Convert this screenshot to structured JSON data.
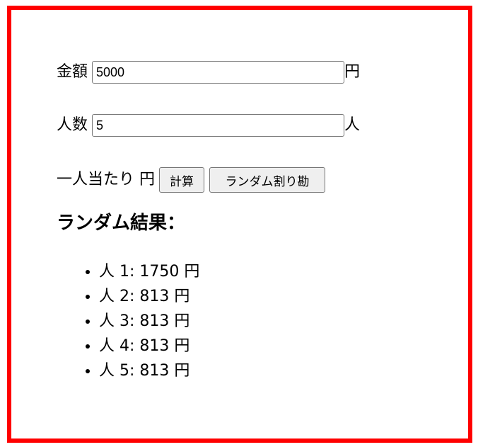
{
  "form": {
    "amount_label": "金額",
    "amount_value": "5000",
    "amount_unit": "円",
    "people_label": "人数",
    "people_value": "5",
    "people_unit": "人",
    "per_person_label": "一人当たり 円",
    "calc_button": "計算",
    "random_button": "ランダム割り勘"
  },
  "results": {
    "heading": "ランダム結果：",
    "items": [
      "人 1: 1750 円",
      "人 2: 813 円",
      "人 3: 813 円",
      "人 4: 813 円",
      "人 5: 813 円"
    ]
  },
  "colors": {
    "frame_border": "#ff0000"
  }
}
